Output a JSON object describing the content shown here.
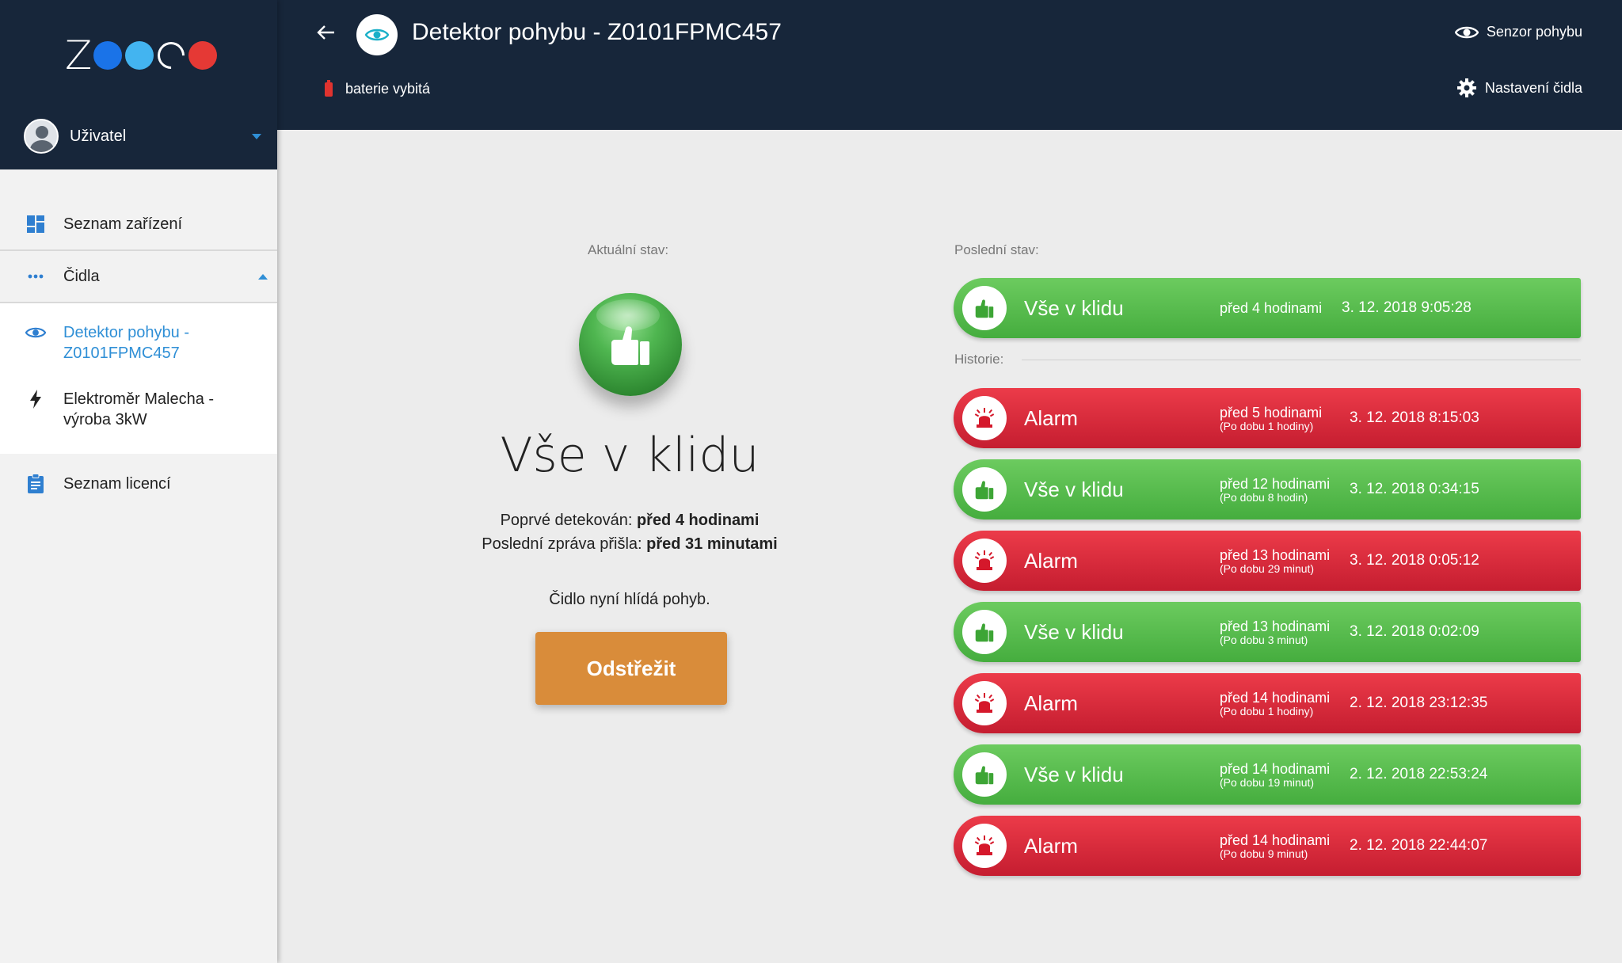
{
  "brand": {
    "logo_letter": "Z",
    "colors": {
      "blue": "#1a73e8",
      "light_blue": "#43b4f0",
      "red": "#e53935"
    }
  },
  "user": {
    "name": "Uživatel"
  },
  "nav": {
    "devices": "Seznam zařízení",
    "sensors": "Čidla",
    "sensor_items": [
      {
        "label_line1": "Detektor pohybu -",
        "label_line2": "Z0101FPMC457",
        "icon": "eye-icon"
      },
      {
        "label_line1": "Elektroměr Malecha -",
        "label_line2": "výroba 3kW",
        "icon": "lightning-icon"
      }
    ],
    "licenses": "Seznam licencí"
  },
  "header": {
    "title": "Detektor pohybu - Z0101FPMC457",
    "battery": "baterie vybitá",
    "sensor_type": "Senzor pohybu",
    "settings": "Nastavení čidla"
  },
  "current": {
    "label": "Aktuální stav:",
    "status": "Vše v klidu",
    "first_detected_label": "Poprvé detekován:",
    "first_detected_value": "před 4 hodinami",
    "last_message_label": "Poslední zpráva přišla:",
    "last_message_value": "před 31 minutami",
    "watch_text": "Čidlo nyní hlídá pohyb.",
    "disarm_button": "Odstřežit"
  },
  "last_state": {
    "label": "Poslední stav:",
    "item": {
      "type": "ok",
      "label": "Vše v klidu",
      "ago": "před 4 hodinami",
      "duration": "",
      "date": "3. 12. 2018 9:05:28"
    }
  },
  "history": {
    "label": "Historie:",
    "items": [
      {
        "type": "alarm",
        "label": "Alarm",
        "ago": "před 5 hodinami",
        "duration": "(Po dobu 1 hodiny)",
        "date": "3. 12. 2018 8:15:03"
      },
      {
        "type": "ok",
        "label": "Vše v klidu",
        "ago": "před 12 hodinami",
        "duration": "(Po dobu 8 hodin)",
        "date": "3. 12. 2018 0:34:15"
      },
      {
        "type": "alarm",
        "label": "Alarm",
        "ago": "před 13 hodinami",
        "duration": "(Po dobu 29 minut)",
        "date": "3. 12. 2018 0:05:12"
      },
      {
        "type": "ok",
        "label": "Vše v klidu",
        "ago": "před 13 hodinami",
        "duration": "(Po dobu 3 minut)",
        "date": "3. 12. 2018 0:02:09"
      },
      {
        "type": "alarm",
        "label": "Alarm",
        "ago": "před 14 hodinami",
        "duration": "(Po dobu 1 hodiny)",
        "date": "2. 12. 2018 23:12:35"
      },
      {
        "type": "ok",
        "label": "Vše v klidu",
        "ago": "před 14 hodinami",
        "duration": "(Po dobu 19 minut)",
        "date": "2. 12. 2018 22:53:24"
      },
      {
        "type": "alarm",
        "label": "Alarm",
        "ago": "před 14 hodinami",
        "duration": "(Po dobu 9 minut)",
        "date": "2. 12. 2018 22:44:07"
      }
    ]
  }
}
